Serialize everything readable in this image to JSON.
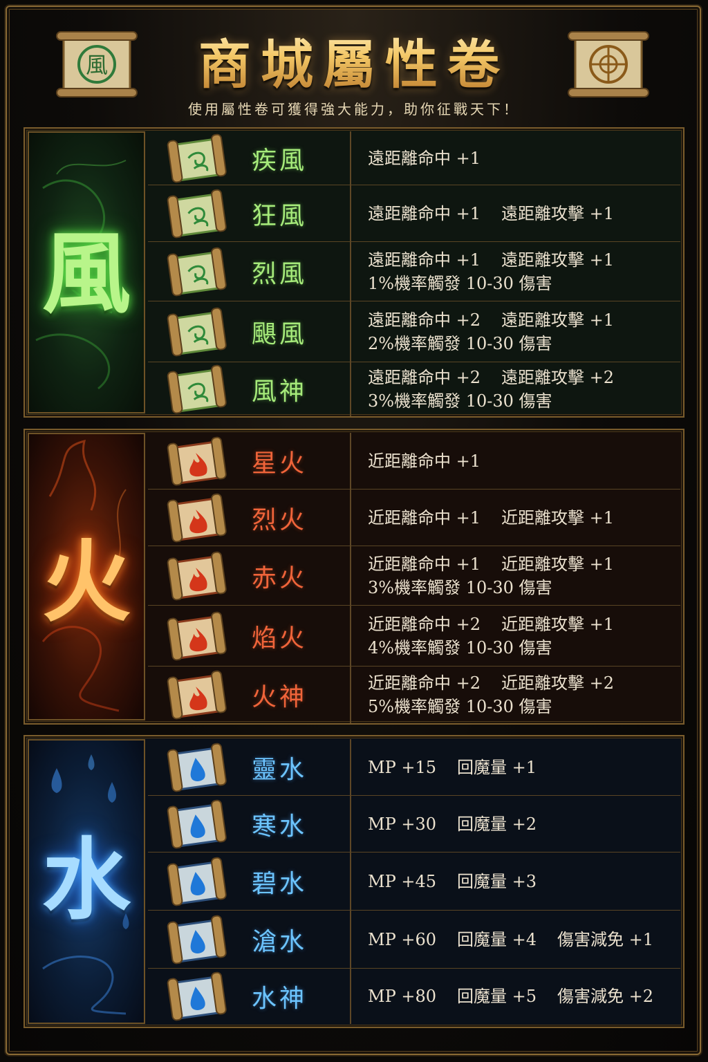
{
  "header": {
    "title": "商城屬性卷",
    "subtitle": "使用屬性卷可獲得強大能力，助你征戰天下！"
  },
  "colors": {
    "gold": "#f3c766",
    "wind": "#a6ea7a",
    "fire": "#f0643a",
    "water": "#6cc4ff",
    "stat_text": "#ece2cf"
  },
  "sections": {
    "wind": {
      "element": "風",
      "icon": "wind-scroll-icon",
      "items": [
        {
          "name": "疾風",
          "stats": [
            "遠距離命中 +1"
          ],
          "line2": ""
        },
        {
          "name": "狂風",
          "stats": [
            "遠距離命中 +1",
            "遠距離攻擊 +1"
          ],
          "line2": ""
        },
        {
          "name": "烈風",
          "stats": [
            "遠距離命中 +1",
            "遠距離攻擊 +1"
          ],
          "line2": "1%機率觸發 10-30 傷害"
        },
        {
          "name": "颶風",
          "stats": [
            "遠距離命中 +2",
            "遠距離攻擊 +1"
          ],
          "line2": "2%機率觸發 10-30 傷害"
        },
        {
          "name": "風神",
          "stats": [
            "遠距離命中 +2",
            "遠距離攻擊 +2"
          ],
          "line2": "3%機率觸發 10-30 傷害"
        }
      ]
    },
    "fire": {
      "element": "火",
      "icon": "fire-scroll-icon",
      "items": [
        {
          "name": "星火",
          "stats": [
            "近距離命中 +1"
          ],
          "line2": ""
        },
        {
          "name": "烈火",
          "stats": [
            "近距離命中 +1",
            "近距離攻擊 +1"
          ],
          "line2": ""
        },
        {
          "name": "赤火",
          "stats": [
            "近距離命中 +1",
            "近距離攻擊 +1"
          ],
          "line2": "3%機率觸發 10-30 傷害"
        },
        {
          "name": "焰火",
          "stats": [
            "近距離命中 +2",
            "近距離攻擊 +1"
          ],
          "line2": "4%機率觸發 10-30 傷害"
        },
        {
          "name": "火神",
          "stats": [
            "近距離命中 +2",
            "近距離攻擊 +2"
          ],
          "line2": "5%機率觸發 10-30 傷害"
        }
      ]
    },
    "water": {
      "element": "水",
      "icon": "water-scroll-icon",
      "items": [
        {
          "name": "靈水",
          "stats": [
            "MP +15",
            "回魔量 +1"
          ],
          "line2": ""
        },
        {
          "name": "寒水",
          "stats": [
            "MP +30",
            "回魔量 +2"
          ],
          "line2": ""
        },
        {
          "name": "碧水",
          "stats": [
            "MP +45",
            "回魔量 +3"
          ],
          "line2": ""
        },
        {
          "name": "滄水",
          "stats": [
            "MP +60",
            "回魔量 +4",
            "傷害減免 +1"
          ],
          "line2": ""
        },
        {
          "name": "水神",
          "stats": [
            "MP +80",
            "回魔量 +5",
            "傷害減免 +2"
          ],
          "line2": ""
        }
      ]
    }
  }
}
